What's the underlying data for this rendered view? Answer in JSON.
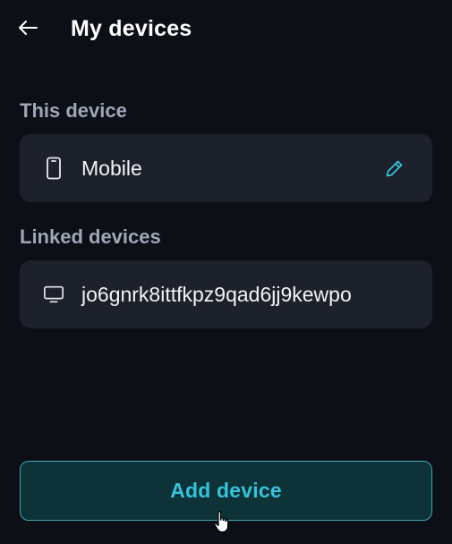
{
  "header": {
    "back_icon": "arrow-left-icon",
    "title": "My devices"
  },
  "this_device": {
    "section_label": "This device",
    "icon": "smartphone-icon",
    "name": "Mobile",
    "edit_icon": "pencil-icon"
  },
  "linked_devices": {
    "section_label": "Linked devices",
    "items": [
      {
        "icon": "monitor-icon",
        "name": "jo6gnrk8ittfkpz9qad6jj9kewpo"
      }
    ]
  },
  "actions": {
    "add_device_label": "Add device"
  },
  "colors": {
    "background": "#0c0f16",
    "card": "#1d212b",
    "accent": "#35c4d9",
    "button_bg": "#0d3238",
    "label_gray": "#9fa6b6"
  }
}
